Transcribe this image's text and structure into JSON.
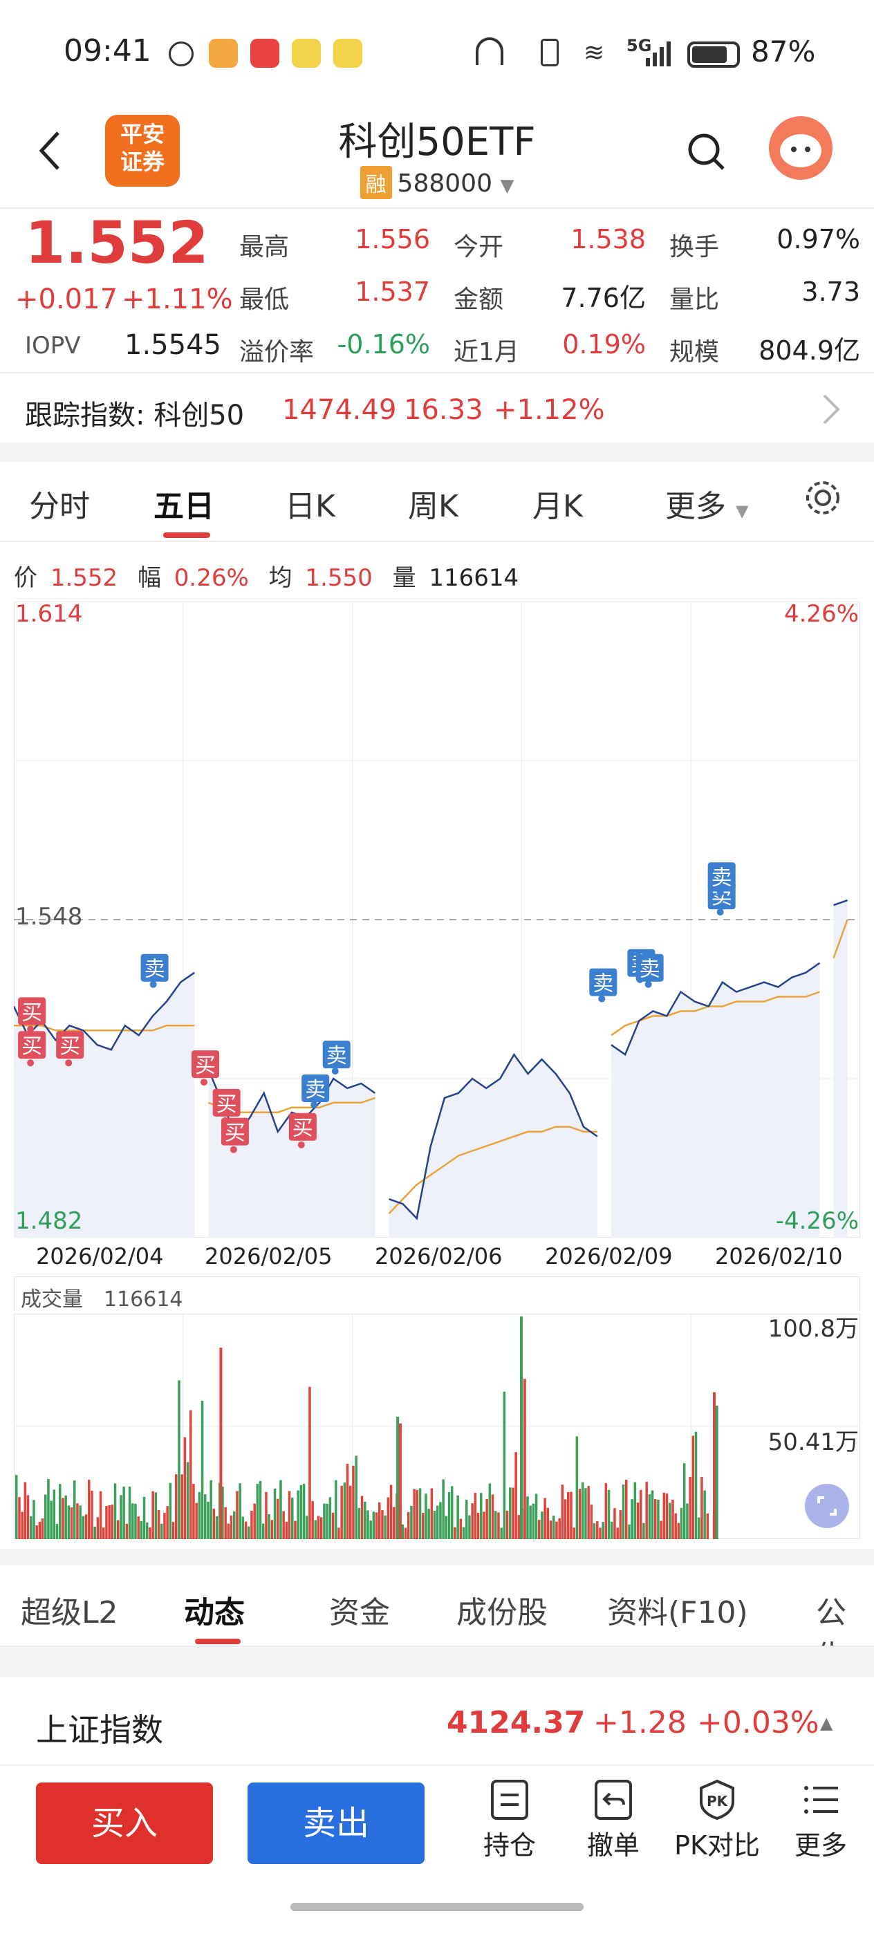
{
  "status_bar": {
    "time": "09:41",
    "network": "5G",
    "battery": "87%"
  },
  "header": {
    "title": "科创50ETF",
    "badge": "融",
    "code": "588000",
    "logo_text": "平安证券"
  },
  "quote": {
    "price": "1.552",
    "change": "+0.017",
    "change_pct": "+1.11%",
    "iopv_label": "IOPV",
    "iopv": "1.5545",
    "fields": [
      {
        "label": "最高",
        "value": "1.556",
        "color": "red"
      },
      {
        "label": "最低",
        "value": "1.537",
        "color": "red"
      },
      {
        "label": "溢价率",
        "value": "-0.16%",
        "color": "green"
      },
      {
        "label": "今开",
        "value": "1.538",
        "color": "red"
      },
      {
        "label": "金额",
        "value": "7.76亿",
        "color": "dark"
      },
      {
        "label": "近1月",
        "value": "0.19%",
        "color": "red"
      },
      {
        "label": "换手",
        "value": "0.97%",
        "color": "dark"
      },
      {
        "label": "量比",
        "value": "3.73",
        "color": "dark"
      },
      {
        "label": "规模",
        "value": "804.9亿",
        "color": "dark"
      }
    ]
  },
  "tracking": {
    "label": "跟踪指数: 科创50",
    "value": "1474.49",
    "change": "16.33",
    "pct": "+1.12%"
  },
  "period_tabs": [
    "分时",
    "五日",
    "日K",
    "周K",
    "月K",
    "更多"
  ],
  "active_period": "五日",
  "chart_info": {
    "price_label": "价",
    "price": "1.552",
    "amp_label": "幅",
    "amp": "0.26%",
    "avg_label": "均",
    "avg": "1.550",
    "vol_label": "量",
    "vol": "116614"
  },
  "chart_data": {
    "type": "line",
    "x": [
      "2026/02/04",
      "2026/02/05",
      "2026/02/06",
      "2026/02/09",
      "2026/02/10"
    ],
    "ylim": [
      1.482,
      1.614
    ],
    "y_labels": {
      "top": "1.614",
      "mid": "1.548",
      "bottom": "1.482",
      "top_pct": "4.26%",
      "bottom_pct": "-4.26%"
    },
    "reference_line": 1.548,
    "series": [
      {
        "values": [
          1.53,
          1.524,
          1.527,
          1.523,
          1.526,
          1.525,
          1.522,
          1.521,
          1.526,
          1.524,
          1.528,
          1.531,
          1.535,
          1.537,
          1.517,
          1.51,
          1.503,
          1.507,
          1.512,
          1.504,
          1.508,
          1.507,
          1.51,
          1.515,
          1.513,
          1.514,
          1.512,
          1.49,
          1.489,
          1.486,
          1.501,
          1.511,
          1.512,
          1.515,
          1.513,
          1.515,
          1.52,
          1.516,
          1.519,
          1.516,
          1.512,
          1.505,
          1.503,
          1.522,
          1.52,
          1.527,
          1.529,
          1.528,
          1.533,
          1.531,
          1.53,
          1.535,
          1.533,
          1.534,
          1.535,
          1.534,
          1.536,
          1.537,
          1.539,
          1.551,
          1.552
        ]
      },
      {
        "values": [
          1.526,
          1.526,
          1.526,
          1.525,
          1.525,
          1.525,
          1.525,
          1.525,
          1.525,
          1.525,
          1.525,
          1.526,
          1.526,
          1.526,
          1.51,
          1.509,
          1.508,
          1.508,
          1.508,
          1.508,
          1.509,
          1.509,
          1.509,
          1.51,
          1.51,
          1.51,
          1.511,
          1.487,
          1.49,
          1.493,
          1.495,
          1.497,
          1.499,
          1.5,
          1.501,
          1.502,
          1.503,
          1.504,
          1.504,
          1.505,
          1.505,
          1.504,
          1.504,
          1.524,
          1.526,
          1.527,
          1.528,
          1.528,
          1.529,
          1.529,
          1.53,
          1.53,
          1.531,
          1.531,
          1.531,
          1.532,
          1.532,
          1.532,
          1.533,
          1.54,
          1.548
        ]
      }
    ],
    "markers": [
      {
        "label": "买",
        "x": 0.005,
        "y": 1.529
      },
      {
        "label": "买",
        "x": 0.005,
        "y": 1.522
      },
      {
        "label": "买",
        "x": 0.05,
        "y": 1.522
      },
      {
        "label": "卖",
        "x": 0.15,
        "y": 1.538
      },
      {
        "label": "买",
        "x": 0.21,
        "y": 1.518
      },
      {
        "label": "买",
        "x": 0.235,
        "y": 1.51
      },
      {
        "label": "买",
        "x": 0.245,
        "y": 1.504
      },
      {
        "label": "买",
        "x": 0.325,
        "y": 1.505
      },
      {
        "label": "卖",
        "x": 0.34,
        "y": 1.513
      },
      {
        "label": "卖",
        "x": 0.365,
        "y": 1.52
      },
      {
        "label": "卖",
        "x": 0.68,
        "y": 1.535
      },
      {
        "label": "卖",
        "x": 0.725,
        "y": 1.539
      },
      {
        "label": "卖",
        "x": 0.735,
        "y": 1.538
      },
      {
        "label": "卖",
        "x": 0.82,
        "y": 1.553
      },
      {
        "label": "卖",
        "x": 0.82,
        "y": 1.557
      }
    ],
    "volume": {
      "label": "成交量",
      "value": "116614",
      "max": "100.8万",
      "mid": "50.41万"
    },
    "colors": {
      "price": "#23428a",
      "avg": "#e8a43a",
      "buy": "#e0505c",
      "sell": "#3b7fd0"
    }
  },
  "bottom_tabs": [
    "超级L2",
    "动态",
    "资金",
    "成份股",
    "资料(F10)",
    "公告"
  ],
  "active_bottom": "动态",
  "index_row": {
    "name": "上证指数",
    "value": "4124.37",
    "change": "+1.28",
    "pct": "+0.03%"
  },
  "actions": {
    "buy": "买入",
    "sell": "卖出",
    "tools": [
      "持仓",
      "撤单",
      "PK对比",
      "更多"
    ]
  }
}
